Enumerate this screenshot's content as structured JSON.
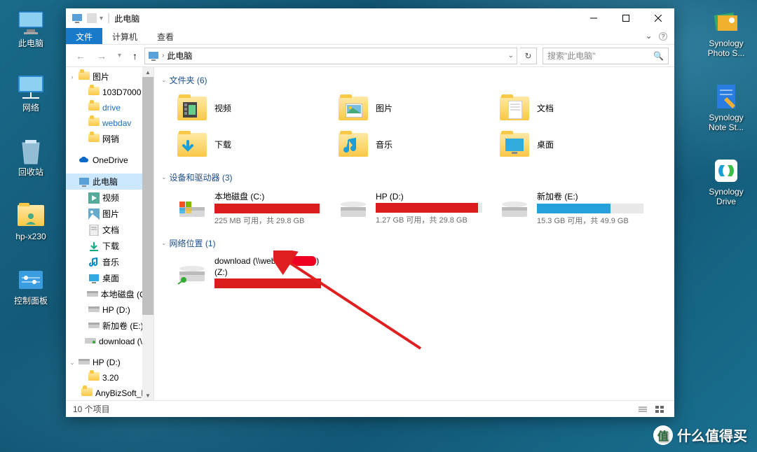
{
  "desktop": {
    "icons_left": [
      {
        "name": "this-pc",
        "label": "此电脑",
        "kind": "monitor"
      },
      {
        "name": "network",
        "label": "网络",
        "kind": "monitor"
      },
      {
        "name": "recycle",
        "label": "回收站",
        "kind": "recycle"
      },
      {
        "name": "hp-x230",
        "label": "hp-x230",
        "kind": "folder"
      },
      {
        "name": "control-panel",
        "label": "控制面板",
        "kind": "panel"
      }
    ],
    "icons_right": [
      {
        "name": "syn-photo",
        "label": "Synology Photo S..."
      },
      {
        "name": "syn-note",
        "label": "Synology Note St..."
      },
      {
        "name": "syn-drive",
        "label": "Synology Drive"
      }
    ]
  },
  "window": {
    "title": "此电脑",
    "ribbon": {
      "file": "文件",
      "tabs": [
        "计算机",
        "查看"
      ]
    },
    "nav": {
      "back": "←",
      "forward": "→",
      "up": "↑"
    },
    "address": {
      "crumb": "此电脑"
    },
    "search": {
      "placeholder": "搜索\"此电脑\""
    },
    "status": {
      "count": "10 个项目"
    }
  },
  "sidebar": [
    {
      "label": "图片",
      "icon": "folder",
      "expand": ">"
    },
    {
      "label": "103D7000",
      "icon": "folder",
      "child": true
    },
    {
      "label": "drive",
      "icon": "folder",
      "child": true,
      "color": "#1a6ecc"
    },
    {
      "label": "webdav",
      "icon": "folder",
      "child": true,
      "color": "#1a6ecc"
    },
    {
      "label": "网销",
      "icon": "folder",
      "child": true
    },
    {
      "label": "OneDrive",
      "icon": "cloud"
    },
    {
      "label": "此电脑",
      "icon": "pc",
      "active": true
    },
    {
      "label": "视频",
      "icon": "video",
      "child": true
    },
    {
      "label": "图片",
      "icon": "pic",
      "child": true
    },
    {
      "label": "文档",
      "icon": "doc",
      "child": true
    },
    {
      "label": "下载",
      "icon": "download",
      "child": true
    },
    {
      "label": "音乐",
      "icon": "music",
      "child": true
    },
    {
      "label": "桌面",
      "icon": "desktop",
      "child": true
    },
    {
      "label": "本地磁盘 (C:)",
      "icon": "drive",
      "child": true
    },
    {
      "label": "HP (D:)",
      "icon": "drive",
      "child": true
    },
    {
      "label": "新加卷 (E:)",
      "icon": "drive",
      "child": true
    },
    {
      "label": "download (\\\\w",
      "icon": "netdrive",
      "child": true
    },
    {
      "label": "HP (D:)",
      "icon": "drive",
      "expand": "v"
    },
    {
      "label": "3.20",
      "icon": "folder",
      "child": true
    },
    {
      "label": "AnyBizSoft_PDF",
      "icon": "folder",
      "child": true
    }
  ],
  "sections": {
    "folders": {
      "title": "文件夹 (6)",
      "items": [
        {
          "name": "视频",
          "icon": "video"
        },
        {
          "name": "图片",
          "icon": "pic"
        },
        {
          "name": "文档",
          "icon": "doc"
        },
        {
          "name": "下载",
          "icon": "download"
        },
        {
          "name": "音乐",
          "icon": "music"
        },
        {
          "name": "桌面",
          "icon": "desktop"
        }
      ]
    },
    "drives": {
      "title": "设备和驱动器 (3)",
      "items": [
        {
          "name": "本地磁盘 (C:)",
          "sub": "225 MB 可用，共 29.8 GB",
          "fill": 99,
          "color": "#da1c1c"
        },
        {
          "name": "HP (D:)",
          "sub": "1.27 GB 可用，共 29.8 GB",
          "fill": 96,
          "color": "#da1c1c"
        },
        {
          "name": "新加卷 (E:)",
          "sub": "15.3 GB 可用，共 49.9 GB",
          "fill": 69,
          "color": "#26a0da"
        }
      ]
    },
    "network": {
      "title": "网络位置 (1)",
      "items": [
        {
          "name": "download (\\\\webdav.",
          "line2": "(Z:)",
          "fill": 100,
          "color": "#da1c1c"
        }
      ]
    }
  },
  "watermark": {
    "text": "什么值得买",
    "badge": "值"
  }
}
